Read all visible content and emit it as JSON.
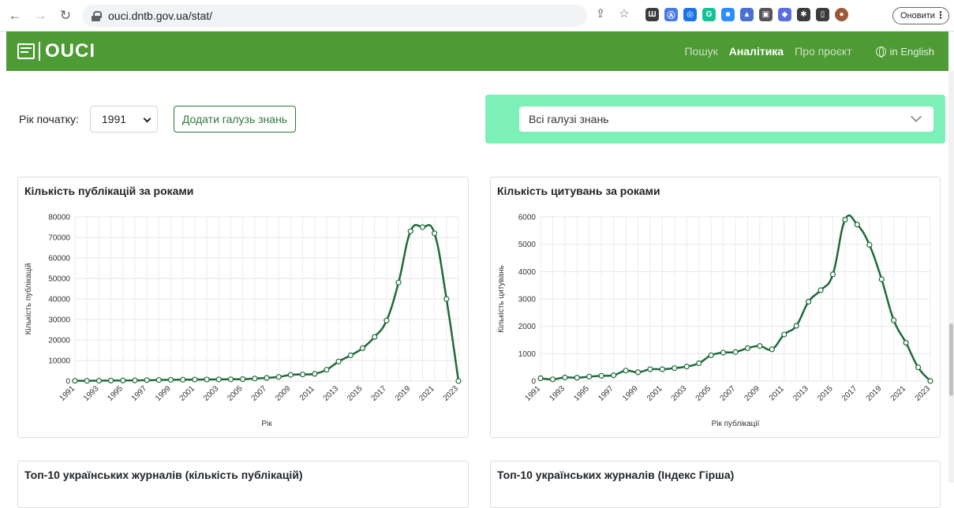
{
  "browser": {
    "url": "ouci.dntb.gov.ua/stat/",
    "update_label": "Оновити",
    "extensions": [
      {
        "name": "translate-icon",
        "color": "#3c3c3c",
        "glyph": "Ш"
      },
      {
        "name": "translate2-icon",
        "color": "#4a7ae0",
        "glyph": "Ⓐ"
      },
      {
        "name": "ring-icon",
        "color": "#1a73e8",
        "glyph": "◎"
      },
      {
        "name": "grammarly-icon",
        "color": "#15c39a",
        "glyph": "G"
      },
      {
        "name": "zoom-icon",
        "color": "#2d8cff",
        "glyph": "■"
      },
      {
        "name": "cap-icon",
        "color": "#4a6fd0",
        "glyph": "▲"
      },
      {
        "name": "extension-icon",
        "color": "#555555",
        "glyph": "▣"
      },
      {
        "name": "shield-icon",
        "color": "#5b6ee0",
        "glyph": "◆"
      },
      {
        "name": "puzzle-icon",
        "color": "#3c3c3c",
        "glyph": "✱"
      },
      {
        "name": "sidepanel-icon",
        "color": "#3c3c3c",
        "glyph": "▯"
      },
      {
        "name": "avatar-icon",
        "color": "#9a5a3a",
        "glyph": "●"
      }
    ]
  },
  "navbar": {
    "logo_text": "OUCI",
    "links": [
      "Пошук",
      "Аналітика",
      "Про проєкт"
    ],
    "active": "Аналітика",
    "lang_label": "in English"
  },
  "filters": {
    "start_year_label": "Рік початку:",
    "start_year_value": "1991",
    "add_field_label": "Додати галузь знань",
    "field_value": "Всі галузі знань"
  },
  "cards": {
    "pub_title": "Кількість публікацій за роками",
    "cit_title": "Кількість цитувань за роками",
    "top_pub_title": "Топ-10 українських журналів (кількість публікацій)",
    "top_h_title": "Топ-10 українських журналів (Індекс Гірша)"
  },
  "chart_data": [
    {
      "type": "line",
      "title": "Кількість публікацій за роками",
      "xlabel": "Рік",
      "ylabel": "Кількість публікацій",
      "xlim": [
        1991,
        2023
      ],
      "ylim": [
        0,
        80000
      ],
      "yticks": [
        0,
        10000,
        20000,
        30000,
        40000,
        50000,
        60000,
        70000,
        80000
      ],
      "xticks": [
        1991,
        1993,
        1995,
        1997,
        1999,
        2001,
        2003,
        2005,
        2007,
        2009,
        2011,
        2013,
        2015,
        2017,
        2019,
        2021,
        2023
      ],
      "grid": true,
      "color": "#1e6a3c",
      "x": [
        1991,
        1992,
        1993,
        1994,
        1995,
        1996,
        1997,
        1998,
        1999,
        2000,
        2001,
        2002,
        2003,
        2004,
        2005,
        2006,
        2007,
        2008,
        2009,
        2010,
        2011,
        2012,
        2013,
        2014,
        2015,
        2016,
        2017,
        2018,
        2019,
        2020,
        2021,
        2022,
        2023
      ],
      "y": [
        100,
        100,
        150,
        200,
        250,
        300,
        400,
        500,
        600,
        650,
        700,
        750,
        800,
        850,
        900,
        1200,
        1500,
        2000,
        3000,
        3200,
        3500,
        5500,
        9500,
        12500,
        16000,
        21500,
        29500,
        48000,
        73000,
        75000,
        72000,
        40000,
        0
      ]
    },
    {
      "type": "line",
      "title": "Кількість цитувань за роками",
      "xlabel": "Рік публікації",
      "ylabel": "Кількість цитувань",
      "xlim": [
        1991,
        2023
      ],
      "ylim": [
        0,
        6000
      ],
      "yticks": [
        0,
        1000,
        2000,
        3000,
        4000,
        5000,
        6000
      ],
      "xticks": [
        1991,
        1993,
        1995,
        1997,
        1999,
        2001,
        2003,
        2005,
        2007,
        2009,
        2011,
        2013,
        2015,
        2017,
        2019,
        2021,
        2023
      ],
      "grid": true,
      "color": "#1e6a3c",
      "x": [
        1991,
        1992,
        1993,
        1994,
        1995,
        1996,
        1997,
        1998,
        1999,
        2000,
        2001,
        2002,
        2003,
        2004,
        2005,
        2006,
        2007,
        2008,
        2009,
        2010,
        2011,
        2012,
        2013,
        2014,
        2015,
        2016,
        2017,
        2018,
        2019,
        2020,
        2021,
        2022,
        2023
      ],
      "y": [
        100,
        60,
        130,
        120,
        160,
        190,
        210,
        380,
        320,
        430,
        430,
        470,
        530,
        650,
        940,
        1040,
        1060,
        1200,
        1280,
        1160,
        1700,
        2020,
        2900,
        3320,
        3900,
        5900,
        5720,
        4980,
        3720,
        2220,
        1400,
        500,
        0
      ]
    }
  ]
}
